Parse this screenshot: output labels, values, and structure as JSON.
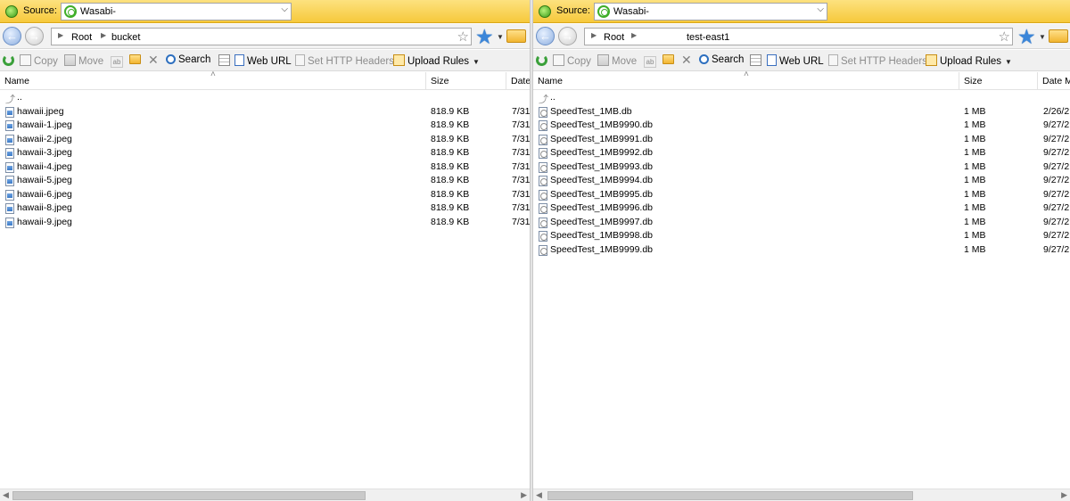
{
  "icons": {
    "source": "wasabi-logo-icon",
    "back": "back-arrow-icon",
    "forward": "forward-arrow-icon",
    "up": "parent-folder-icon",
    "image_file": "image-file-icon",
    "db_file": "db-file-icon"
  },
  "colors": {
    "source_bar": "#fbd35e",
    "nav_blue": "#3b86d9",
    "wasabi_green": "#3fae29"
  },
  "left": {
    "source": {
      "label": "Source:",
      "value": "Wasabi-"
    },
    "breadcrumb": [
      "Root",
      "bucket"
    ],
    "toolbar": {
      "copy": "Copy",
      "move": "Move",
      "search": "Search",
      "web_url": "Web URL",
      "set_http_headers": "Set HTTP Headers",
      "upload_rules": "Upload Rules"
    },
    "columns": {
      "name": "Name",
      "size": "Size",
      "date": "Date"
    },
    "up_label": "..",
    "files": [
      {
        "name": "hawaii.jpeg",
        "size": "818.9 KB",
        "date": "7/31"
      },
      {
        "name": "hawaii-1.jpeg",
        "size": "818.9 KB",
        "date": "7/31"
      },
      {
        "name": "hawaii-2.jpeg",
        "size": "818.9 KB",
        "date": "7/31"
      },
      {
        "name": "hawaii-3.jpeg",
        "size": "818.9 KB",
        "date": "7/31"
      },
      {
        "name": "hawaii-4.jpeg",
        "size": "818.9 KB",
        "date": "7/31"
      },
      {
        "name": "hawaii-5.jpeg",
        "size": "818.9 KB",
        "date": "7/31"
      },
      {
        "name": "hawaii-6.jpeg",
        "size": "818.9 KB",
        "date": "7/31"
      },
      {
        "name": "hawaii-8.jpeg",
        "size": "818.9 KB",
        "date": "7/31"
      },
      {
        "name": "hawaii-9.jpeg",
        "size": "818.9 KB",
        "date": "7/31"
      }
    ]
  },
  "right": {
    "source": {
      "label": "Source:",
      "value": "Wasabi-"
    },
    "breadcrumb": [
      "Root",
      "test-east1"
    ],
    "toolbar": {
      "copy": "Copy",
      "move": "Move",
      "search": "Search",
      "web_url": "Web URL",
      "set_http_headers": "Set HTTP Headers",
      "upload_rules": "Upload Rules"
    },
    "columns": {
      "name": "Name",
      "size": "Size",
      "date": "Date M"
    },
    "up_label": "..",
    "files": [
      {
        "name": "SpeedTest_1MB.db",
        "size": "1 MB",
        "date": "2/26/2"
      },
      {
        "name": "SpeedTest_1MB9990.db",
        "size": "1 MB",
        "date": "9/27/2"
      },
      {
        "name": "SpeedTest_1MB9991.db",
        "size": "1 MB",
        "date": "9/27/2"
      },
      {
        "name": "SpeedTest_1MB9992.db",
        "size": "1 MB",
        "date": "9/27/2"
      },
      {
        "name": "SpeedTest_1MB9993.db",
        "size": "1 MB",
        "date": "9/27/2"
      },
      {
        "name": "SpeedTest_1MB9994.db",
        "size": "1 MB",
        "date": "9/27/2"
      },
      {
        "name": "SpeedTest_1MB9995.db",
        "size": "1 MB",
        "date": "9/27/2"
      },
      {
        "name": "SpeedTest_1MB9996.db",
        "size": "1 MB",
        "date": "9/27/2"
      },
      {
        "name": "SpeedTest_1MB9997.db",
        "size": "1 MB",
        "date": "9/27/2"
      },
      {
        "name": "SpeedTest_1MB9998.db",
        "size": "1 MB",
        "date": "9/27/2"
      },
      {
        "name": "SpeedTest_1MB9999.db",
        "size": "1 MB",
        "date": "9/27/2"
      }
    ]
  }
}
